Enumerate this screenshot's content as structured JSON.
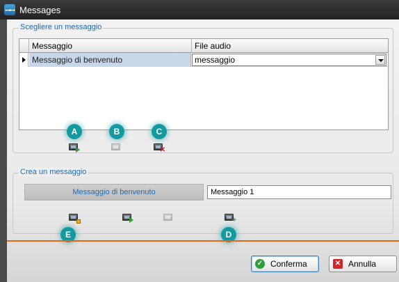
{
  "window": {
    "title": "Messages",
    "app_icon": "app-icon"
  },
  "choose_group": {
    "legend": "Scegliere un messaggio",
    "table": {
      "headers": [
        "Messaggio",
        "File audio"
      ],
      "rows": [
        {
          "message": "Messaggio di benvenuto",
          "audio_file": "messaggio"
        }
      ]
    },
    "callouts": [
      "A",
      "B",
      "C"
    ]
  },
  "create_group": {
    "legend": "Crea un messaggio",
    "message_label": "Messaggio di benvenuto",
    "name_input_value": "Messaggio 1",
    "callouts": [
      "E",
      "D"
    ]
  },
  "buttons": {
    "confirm": "Conferma",
    "cancel": "Annulla"
  },
  "colors": {
    "accent_blue": "#1e6ab5",
    "callout_teal": "#129aa0",
    "divider_orange": "#e06a1a",
    "row_selected": "#c7d6e8"
  }
}
